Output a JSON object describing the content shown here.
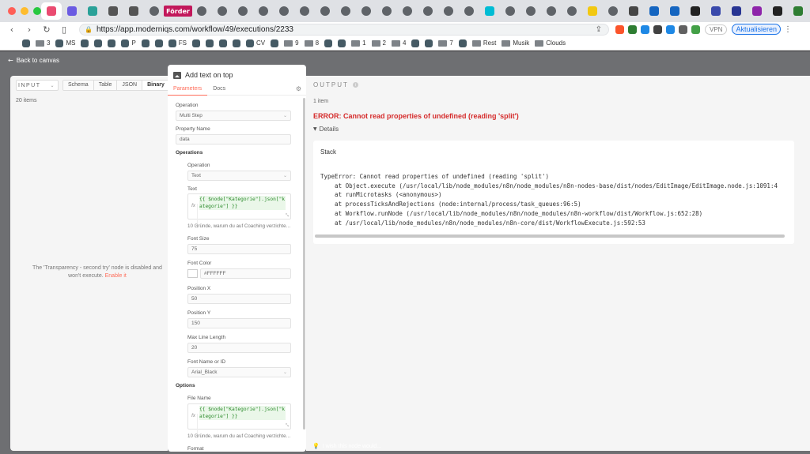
{
  "browser": {
    "tabs": [
      {
        "icon": "n8n-icon",
        "color": "#ea4b71",
        "active": true
      },
      {
        "icon": "one-icon",
        "color": "#6b5be2"
      },
      {
        "icon": "leaf-icon",
        "color": "#2aa198"
      },
      {
        "icon": "n8n-icon",
        "color": "#555555"
      },
      {
        "icon": "n8n-icon",
        "color": "#555555"
      },
      {
        "icon": "globe-icon",
        "color": "#5f6368"
      },
      {
        "icon": "foerder-icon",
        "color": "#c2185b",
        "label": "Förder"
      },
      {
        "icon": "globe-icon",
        "color": "#5f6368"
      },
      {
        "icon": "globe-icon",
        "color": "#5f6368"
      },
      {
        "icon": "globe-icon",
        "color": "#5f6368"
      },
      {
        "icon": "globe-icon",
        "color": "#5f6368"
      },
      {
        "icon": "globe-icon",
        "color": "#5f6368"
      },
      {
        "icon": "globe-icon",
        "color": "#5f6368"
      },
      {
        "icon": "globe-icon",
        "color": "#5f6368"
      },
      {
        "icon": "globe-icon",
        "color": "#5f6368"
      },
      {
        "icon": "globe-icon",
        "color": "#5f6368"
      },
      {
        "icon": "globe-icon",
        "color": "#5f6368"
      },
      {
        "icon": "globe-icon",
        "color": "#5f6368"
      },
      {
        "icon": "globe-icon",
        "color": "#5f6368"
      },
      {
        "icon": "globe-icon",
        "color": "#5f6368"
      },
      {
        "icon": "globe-icon",
        "color": "#5f6368"
      },
      {
        "icon": "teal-icon",
        "color": "#00bcd4"
      },
      {
        "icon": "globe-icon",
        "color": "#5f6368"
      },
      {
        "icon": "globe-icon",
        "color": "#5f6368"
      },
      {
        "icon": "globe-icon",
        "color": "#5f6368"
      },
      {
        "icon": "globe-icon",
        "color": "#5f6368"
      },
      {
        "icon": "yellow-icon",
        "color": "#f2c811"
      },
      {
        "icon": "globe-icon",
        "color": "#5f6368"
      },
      {
        "icon": "wordpress-icon",
        "color": "#464646"
      },
      {
        "icon": "c-icon",
        "color": "#1565c0"
      },
      {
        "icon": "c-icon",
        "color": "#1565c0"
      },
      {
        "icon": "b-icon",
        "color": "#222222"
      },
      {
        "icon": "hand-icon",
        "color": "#3949ab"
      },
      {
        "icon": "person-icon",
        "color": "#283593"
      },
      {
        "icon": "flag-icon",
        "color": "#8e24aa"
      },
      {
        "icon": "b-icon",
        "color": "#222222"
      },
      {
        "icon": "v-icon",
        "color": "#2e7d32"
      }
    ],
    "new_tab": "+",
    "url": "https://app.moderniqs.com/workflow/49/executions/2233",
    "vpn_label": "VPN",
    "update_label": "Aktualisieren",
    "bookmarks": [
      {
        "icon": "shield-icon",
        "label": ""
      },
      {
        "icon": "folder-icon",
        "label": "3"
      },
      {
        "icon": "globe-icon",
        "label": "MS"
      },
      {
        "icon": "globe-icon",
        "label": ""
      },
      {
        "icon": "star-icon",
        "label": ""
      },
      {
        "icon": "m-icon",
        "label": ""
      },
      {
        "icon": "m-icon",
        "label": "P"
      },
      {
        "icon": "globe-icon",
        "label": ""
      },
      {
        "icon": "globe-icon",
        "label": ""
      },
      {
        "icon": "globe-icon",
        "label": "FS"
      },
      {
        "icon": "wave-icon",
        "label": ""
      },
      {
        "icon": "globe-icon",
        "label": ""
      },
      {
        "icon": "twitter-icon",
        "label": ""
      },
      {
        "icon": "twitter-icon",
        "label": ""
      },
      {
        "icon": "facebook-icon",
        "label": "CV"
      },
      {
        "icon": "globe-icon",
        "label": ""
      },
      {
        "icon": "folder-icon",
        "label": "9"
      },
      {
        "icon": "folder-icon",
        "label": "8"
      },
      {
        "icon": "globe-icon",
        "label": ""
      },
      {
        "icon": "three-icon",
        "label": ""
      },
      {
        "icon": "folder-icon",
        "label": "1"
      },
      {
        "icon": "folder-icon",
        "label": "2"
      },
      {
        "icon": "folder-icon",
        "label": "4"
      },
      {
        "icon": "youtube-icon",
        "label": ""
      },
      {
        "icon": "google-icon",
        "label": ""
      },
      {
        "icon": "folder-icon",
        "label": "7"
      },
      {
        "icon": "v-icon",
        "label": ""
      },
      {
        "icon": "folder-icon",
        "label": "Rest"
      },
      {
        "icon": "folder-icon",
        "label": "Musik"
      },
      {
        "icon": "folder-icon",
        "label": "Clouds"
      }
    ]
  },
  "app": {
    "back_label": "Back to canvas",
    "input": {
      "select_label": "INPUT",
      "modes": [
        "Schema",
        "Table",
        "JSON",
        "Binary"
      ],
      "active_mode": "Binary",
      "count": "20 items",
      "disabled_msg": "The 'Transparency - second try' node is disabled and won't execute.",
      "enable_link": "Enable it"
    },
    "params": {
      "title": "Add text on top",
      "tabs": [
        "Parameters",
        "Docs"
      ],
      "operation_label": "Operation",
      "operation_value": "Multi Step",
      "property_label": "Property Name",
      "property_value": "data",
      "operations_section": "Operations",
      "sub_operation_label": "Operation",
      "sub_operation_value": "Text",
      "text_label": "Text",
      "text_fx": "fx",
      "text_code": "{{ $node[\"Kategorie\"].json[\"kategorie\"] }}",
      "text_preview": "10 Gründe, warum du auf Coaching verzichten solltest",
      "font_size_label": "Font Size",
      "font_size_value": "75",
      "font_color_label": "Font Color",
      "font_color_value": "#FFFFFF",
      "pos_x_label": "Position X",
      "pos_x_value": "50",
      "pos_y_label": "Position Y",
      "pos_y_value": "150",
      "max_line_label": "Max Line Length",
      "max_line_value": "20",
      "font_name_label": "Font Name or ID",
      "font_name_value": "Arial_Black",
      "options_section": "Options",
      "file_name_label": "File Name",
      "file_name_fx": "fx",
      "file_name_code": "{{ $node[\"Kategorie\"].json[\"kategorie\"] }}",
      "file_name_preview": "10 Gründe, warum du auf Coaching verzichten solltest",
      "format_label": "Format"
    },
    "output": {
      "title": "OUTPUT",
      "count": "1 item",
      "error": "ERROR: Cannot read properties of undefined (reading 'split')",
      "details": "Details",
      "stack_title": "Stack",
      "stack_lines": [
        "TypeError: Cannot read properties of undefined (reading 'split')",
        "    at Object.execute (/usr/local/lib/node_modules/n8n/node_modules/n8n-nodes-base/dist/nodes/EditImage/EditImage.node.js:1091:4",
        "    at runMicrotasks (<anonymous>)",
        "    at processTicksAndRejections (node:internal/process/task_queues:96:5)",
        "    at Workflow.runNode (/usr/local/lib/node_modules/n8n/node_modules/n8n-workflow/dist/Workflow.js:652:28)",
        "    at /usr/local/lib/node_modules/n8n/node_modules/n8n-core/dist/WorkflowExecute.js:592:53"
      ]
    },
    "wish_label": "I wish this node would..."
  }
}
